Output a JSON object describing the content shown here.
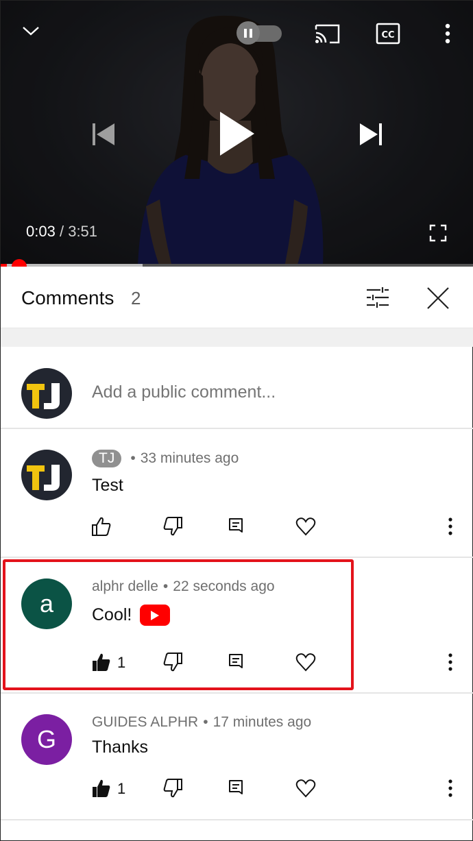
{
  "player": {
    "current_time": "0:03",
    "separator": "/",
    "duration": "3:51",
    "progress_fraction": 0.013,
    "buffered_fraction": 0.3,
    "autoplay_toggle": "paused-off",
    "icons": {
      "minimize": "chevron-down-icon",
      "autoplay": "autoplay-toggle",
      "cast": "cast-icon",
      "captions": "closed-captions-icon",
      "more": "more-vert-icon",
      "previous": "skip-previous-icon",
      "play": "play-icon",
      "next": "skip-next-icon",
      "fullscreen": "fullscreen-icon"
    },
    "captions_label": "CC"
  },
  "comments_panel": {
    "title": "Comments",
    "count": "2",
    "sort_icon": "sort-filter-icon",
    "close_icon": "close-icon",
    "composer": {
      "avatar_text": "TJ",
      "placeholder": "Add a public comment..."
    },
    "comments": [
      {
        "author": "TJ",
        "author_is_badge": true,
        "time": "33 minutes ago",
        "text": "Test",
        "likes": "",
        "avatar": {
          "text": "TJ",
          "color": "#222630"
        },
        "highlighted": false
      },
      {
        "author": "alphr delle",
        "author_is_badge": false,
        "time": "22 seconds ago",
        "text": "Cool!",
        "emoji": "youtube-logo",
        "likes": "1",
        "liked": true,
        "avatar": {
          "text": "a",
          "color": "#0b5345"
        },
        "highlighted": true
      },
      {
        "author": "GUIDES ALPHR",
        "author_is_badge": false,
        "time": "17 minutes ago",
        "text": "Thanks",
        "likes": "1",
        "liked": true,
        "avatar": {
          "text": "G",
          "color": "#7b1fa2"
        },
        "highlighted": false
      }
    ],
    "meta_separator": "•"
  },
  "colors": {
    "accent_red": "#ff0000",
    "highlight_border": "#e3131b",
    "text_primary": "#0f0f0f",
    "text_secondary": "#6f6f6f"
  }
}
